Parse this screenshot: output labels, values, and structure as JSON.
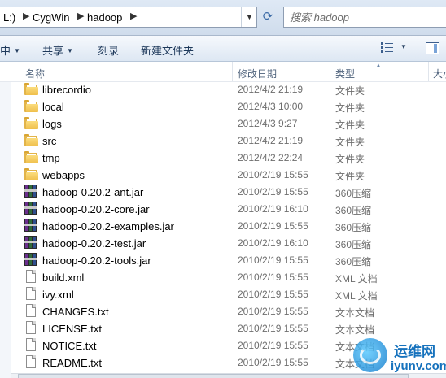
{
  "address_bar": {
    "crumbs": [
      "L:)",
      "CygWin",
      "hadoop"
    ],
    "refresh_icon": "refresh-icon"
  },
  "search": {
    "placeholder": "搜索 hadoop"
  },
  "toolbar": {
    "left_fragment": "中",
    "share_label": "共享",
    "burn_label": "刻录",
    "new_folder_label": "新建文件夹"
  },
  "columns": {
    "name": "名称",
    "date": "修改日期",
    "type": "类型",
    "size": "大小"
  },
  "files": [
    {
      "name": "librecordio",
      "date": "2012/4/2 21:19",
      "type": "文件夹",
      "icon": "folder-icon"
    },
    {
      "name": "local",
      "date": "2012/4/3 10:00",
      "type": "文件夹",
      "icon": "folder-icon"
    },
    {
      "name": "logs",
      "date": "2012/4/3 9:27",
      "type": "文件夹",
      "icon": "folder-icon"
    },
    {
      "name": "src",
      "date": "2012/4/2 21:19",
      "type": "文件夹",
      "icon": "folder-icon"
    },
    {
      "name": "tmp",
      "date": "2012/4/2 22:24",
      "type": "文件夹",
      "icon": "folder-icon"
    },
    {
      "name": "webapps",
      "date": "2010/2/19 15:55",
      "type": "文件夹",
      "icon": "folder-icon"
    },
    {
      "name": "hadoop-0.20.2-ant.jar",
      "date": "2010/2/19 15:55",
      "type": "360压缩",
      "icon": "archive-icon"
    },
    {
      "name": "hadoop-0.20.2-core.jar",
      "date": "2010/2/19 16:10",
      "type": "360压缩",
      "icon": "archive-icon"
    },
    {
      "name": "hadoop-0.20.2-examples.jar",
      "date": "2010/2/19 15:55",
      "type": "360压缩",
      "icon": "archive-icon"
    },
    {
      "name": "hadoop-0.20.2-test.jar",
      "date": "2010/2/19 16:10",
      "type": "360压缩",
      "icon": "archive-icon"
    },
    {
      "name": "hadoop-0.20.2-tools.jar",
      "date": "2010/2/19 15:55",
      "type": "360压缩",
      "icon": "archive-icon"
    },
    {
      "name": "build.xml",
      "date": "2010/2/19 15:55",
      "type": "XML 文档",
      "icon": "document-icon"
    },
    {
      "name": "ivy.xml",
      "date": "2010/2/19 15:55",
      "type": "XML 文档",
      "icon": "document-icon"
    },
    {
      "name": "CHANGES.txt",
      "date": "2010/2/19 15:55",
      "type": "文本文档",
      "icon": "document-icon"
    },
    {
      "name": "LICENSE.txt",
      "date": "2010/2/19 15:55",
      "type": "文本文档",
      "icon": "document-icon"
    },
    {
      "name": "NOTICE.txt",
      "date": "2010/2/19 15:55",
      "type": "文本文档",
      "icon": "document-icon"
    },
    {
      "name": "README.txt",
      "date": "2010/2/19 15:55",
      "type": "文本文档",
      "icon": "document-icon"
    }
  ],
  "watermark": {
    "text_cn": "运维网",
    "text_en": "iyunv.com"
  },
  "colors": {
    "toolbar_text": "#1e395b",
    "meta_text": "#6d6d6d",
    "folder": "#efbf4c",
    "watermark": "#1672bd"
  }
}
